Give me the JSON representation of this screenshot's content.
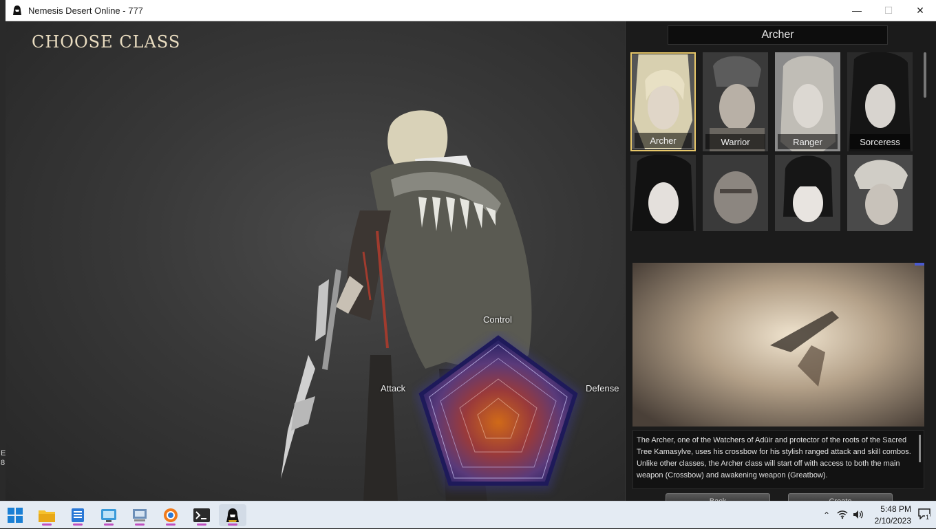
{
  "window": {
    "title": "Nemesis Desert Online - 777",
    "minimize_icon": "minimize-icon",
    "maximize_icon": "maximize-icon",
    "close_icon": "close-icon"
  },
  "desktop_edge_text": "E\n8",
  "game": {
    "heading": "CHOOSE CLASS",
    "radar": {
      "labels": {
        "top": "Control",
        "left": "Attack",
        "right": "Defense"
      }
    }
  },
  "panel": {
    "selected_class": "Archer",
    "classes": [
      {
        "name": "Archer",
        "selected": true
      },
      {
        "name": "Warrior",
        "selected": false
      },
      {
        "name": "Ranger",
        "selected": false
      },
      {
        "name": "Sorceress",
        "selected": false
      },
      {
        "name": "",
        "selected": false
      },
      {
        "name": "",
        "selected": false
      },
      {
        "name": "",
        "selected": false
      },
      {
        "name": "",
        "selected": false
      }
    ],
    "description": "The Archer, one of the Watchers of Adûir and protector of the roots of the Sacred Tree Kamasylve, uses his crossbow for his stylish ranged attack and skill combos. Unlike other classes, the Archer class will start off with access to both the main weapon (Crossbow) and awakening weapon (Greatbow).",
    "buttons": {
      "left": "Back",
      "right": "Create"
    }
  },
  "taskbar": {
    "apps": [
      "start-icon",
      "file-explorer-icon",
      "notepad-icon",
      "control-panel-icon",
      "remote-desktop-icon",
      "browser-icon",
      "terminal-icon",
      "game-icon"
    ],
    "clock": {
      "time": "5:48 PM",
      "date": "2/10/2023"
    },
    "notification_count": "1"
  },
  "colors": {
    "accent_gold": "#e8c86a",
    "heading": "#e9dcc0",
    "radar_fill": "#c06020",
    "radar_outer": "#2a2370"
  }
}
